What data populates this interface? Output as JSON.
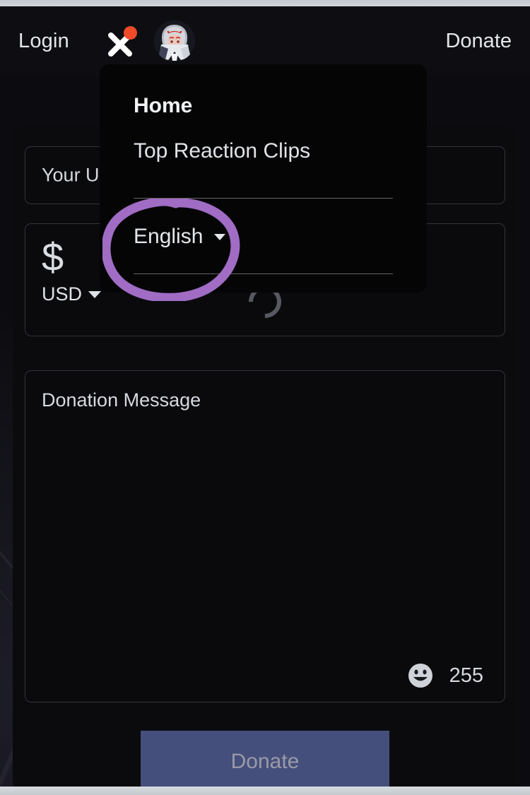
{
  "colors": {
    "page_background": "#0c0c10",
    "card_background": "#0b0b0e",
    "dropdown_background": "#050506",
    "donate_button": "#454f7c",
    "donate_button_text": "#9a9aa6",
    "annotation_purple": "#a06cc4",
    "notification_dot": "#f04a2a",
    "text_primary": "#e3e6ea",
    "field_border": "#33343a"
  },
  "topbar": {
    "login_label": "Login",
    "close_icon": "close-x-icon",
    "notification_dot": true,
    "avatar_icon": "user-avatar-anime",
    "donate_label": "Donate"
  },
  "dropdown": {
    "home_label": "Home",
    "clips_label": "Top Reaction Clips",
    "language_label": "English",
    "language_caret_icon": "chevron-down-icon"
  },
  "form": {
    "username_placeholder": "Your Username",
    "currency_symbol": "$",
    "currency_code": "USD",
    "currency_caret_icon": "chevron-down-icon",
    "amount_value": "",
    "amount_loading": true,
    "message_placeholder": "Donation Message",
    "message_value": "",
    "emoji_icon": "smiley-face-icon",
    "char_count": "255"
  },
  "submit": {
    "label": "Donate"
  },
  "annotation": {
    "shape": "hand-drawn-circle",
    "target": "English language selector"
  }
}
